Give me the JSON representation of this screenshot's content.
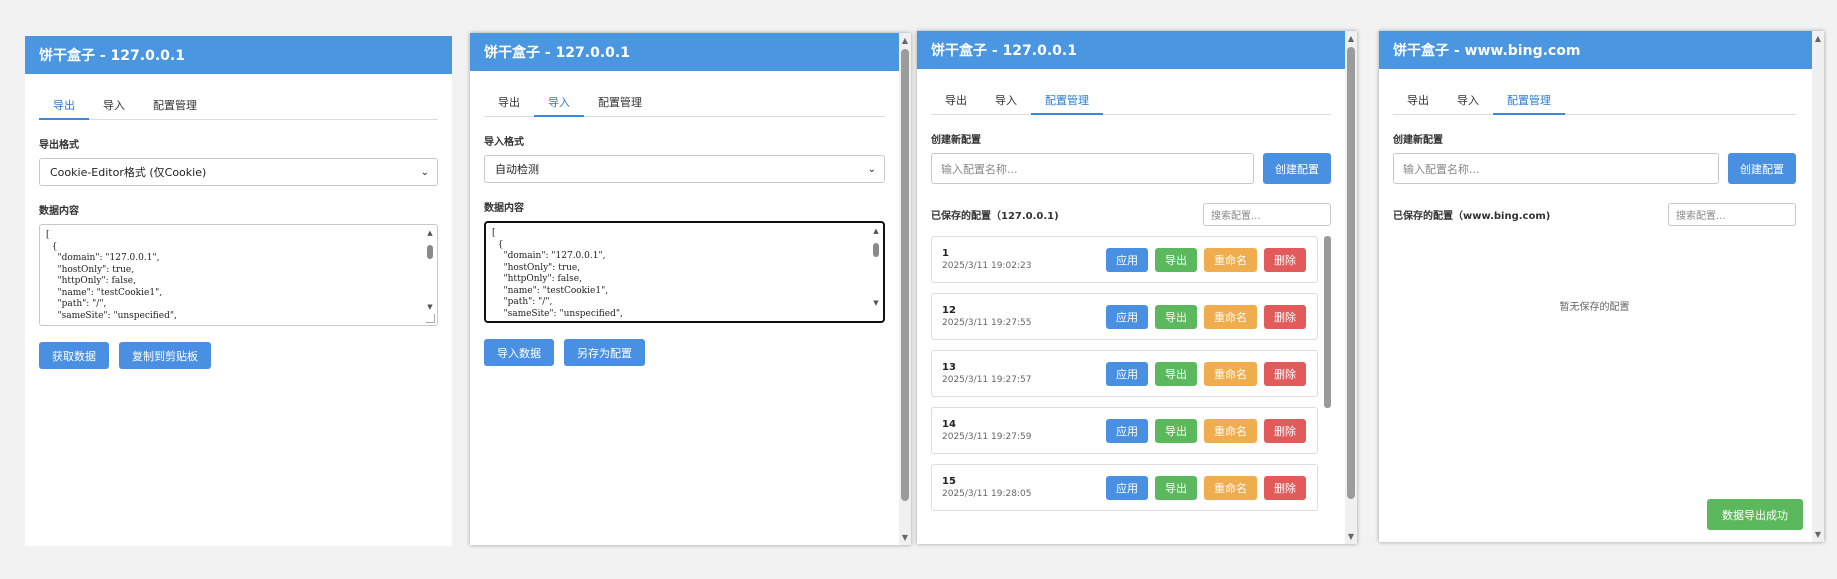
{
  "panels": [
    {
      "title": "饼干盒子 - 127.0.0.1",
      "tabs": [
        "导出",
        "导入",
        "配置管理"
      ],
      "active_tab": 0,
      "format_label": "导出格式",
      "format_value": "Cookie-Editor格式 (仅Cookie)",
      "data_label": "数据内容",
      "data_text": "[\n  {\n    \"domain\": \"127.0.0.1\",\n    \"hostOnly\": true,\n    \"httpOnly\": false,\n    \"name\": \"testCookie1\",\n    \"path\": \"/\",\n    \"sameSite\": \"unspecified\",",
      "buttons": [
        "获取数据",
        "复制到剪贴板"
      ]
    },
    {
      "title": "饼干盒子 - 127.0.0.1",
      "tabs": [
        "导出",
        "导入",
        "配置管理"
      ],
      "active_tab": 1,
      "format_label": "导入格式",
      "format_value": "自动检测",
      "data_label": "数据内容",
      "data_text": "[\n  {\n    \"domain\": \"127.0.0.1\",\n    \"hostOnly\": true,\n    \"httpOnly\": false,\n    \"name\": \"testCookie1\",\n    \"path\": \"/\",\n    \"sameSite\": \"unspecified\",",
      "buttons": [
        "导入数据",
        "另存为配置"
      ]
    },
    {
      "title": "饼干盒子 - 127.0.0.1",
      "tabs": [
        "导出",
        "导入",
        "配置管理"
      ],
      "active_tab": 2,
      "create_label": "创建新配置",
      "name_placeholder": "输入配置名称...",
      "create_button": "创建配置",
      "saved_label": "已保存的配置（127.0.0.1)",
      "search_placeholder": "搜索配置...",
      "configs": [
        {
          "name": "1",
          "date": "2025/3/11 19:02:23"
        },
        {
          "name": "12",
          "date": "2025/3/11 19:27:55"
        },
        {
          "name": "13",
          "date": "2025/3/11 19:27:57"
        },
        {
          "name": "14",
          "date": "2025/3/11 19:27:59"
        },
        {
          "name": "15",
          "date": "2025/3/11 19:28:05"
        }
      ],
      "actions": [
        "应用",
        "导出",
        "重命名",
        "删除"
      ]
    },
    {
      "title": "饼干盒子 - www.bing.com",
      "tabs": [
        "导出",
        "导入",
        "配置管理"
      ],
      "active_tab": 2,
      "create_label": "创建新配置",
      "name_placeholder": "输入配置名称...",
      "create_button": "创建配置",
      "saved_label": "已保存的配置（www.bing.com)",
      "search_placeholder": "搜索配置...",
      "empty_text": "暂无保存的配置",
      "toast": "数据导出成功"
    }
  ],
  "colors": {
    "header": "#4a96e0",
    "primary": "#4a90e2",
    "success": "#5cb85c",
    "warning": "#f0ad4e",
    "danger": "#e25a5a"
  }
}
